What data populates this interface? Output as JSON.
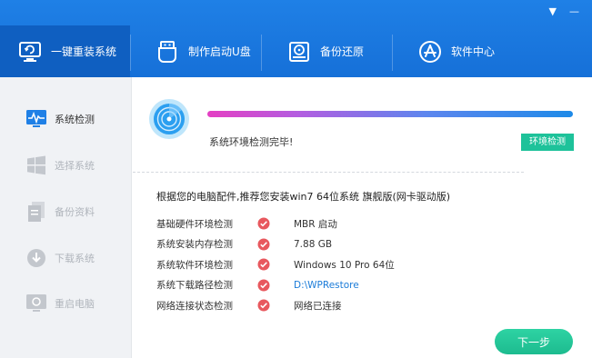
{
  "window_controls": {
    "dropdown": "▼",
    "minimize": "—"
  },
  "nav": {
    "tabs": [
      {
        "label": "一键重装系统",
        "icon": "monitor-refresh-icon",
        "active": true
      },
      {
        "label": "制作启动U盘",
        "icon": "usb-drive-icon",
        "active": false
      },
      {
        "label": "备份还原",
        "icon": "hard-disk-icon",
        "active": false
      },
      {
        "label": "软件中心",
        "icon": "app-store-icon",
        "active": false
      }
    ]
  },
  "sidebar": {
    "items": [
      {
        "label": "系统检测",
        "icon": "monitor-pulse-icon",
        "active": true
      },
      {
        "label": "选择系统",
        "icon": "windows-logo-icon",
        "active": false
      },
      {
        "label": "备份资料",
        "icon": "documents-icon",
        "active": false
      },
      {
        "label": "下载系统",
        "icon": "download-circle-icon",
        "active": false
      },
      {
        "label": "重启电脑",
        "icon": "restart-monitor-icon",
        "active": false
      }
    ]
  },
  "main": {
    "progress_percent": 100,
    "status_text": "系统环境检测完毕!",
    "status_badge": "环境检测",
    "recommendation": "根据您的电脑配件,推荐您安装win7 64位系统 旗舰版(网卡驱动版)",
    "checks": [
      {
        "label": "基础硬件环境检测",
        "value": "MBR 启动"
      },
      {
        "label": "系统安装内存检测",
        "value": "7.88 GB"
      },
      {
        "label": "系统软件环境检测",
        "value": "Windows 10 Pro 64位"
      },
      {
        "label": "系统下载路径检测",
        "value": "D:\\WPRestore"
      },
      {
        "label": "网络连接状态检测",
        "value": "网络已连接"
      }
    ],
    "next_button": "下一步"
  },
  "colors": {
    "header": "#1f80e6",
    "accent_green": "#1ec29a",
    "check_red": "#e8585e",
    "link": "#1a7bd8"
  }
}
